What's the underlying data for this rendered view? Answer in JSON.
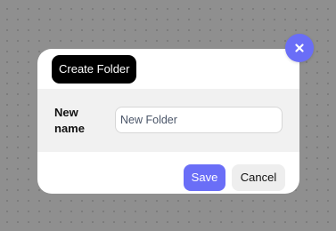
{
  "dialog": {
    "title": "Create Folder",
    "field_label": "New name",
    "input_value": "New Folder",
    "save_label": "Save",
    "cancel_label": "Cancel",
    "close_icon": "close-icon"
  },
  "colors": {
    "accent": "#6a6ef7",
    "title_badge": "#000000",
    "body_band": "#f1f1f1",
    "backdrop": "#8f8f8f"
  }
}
